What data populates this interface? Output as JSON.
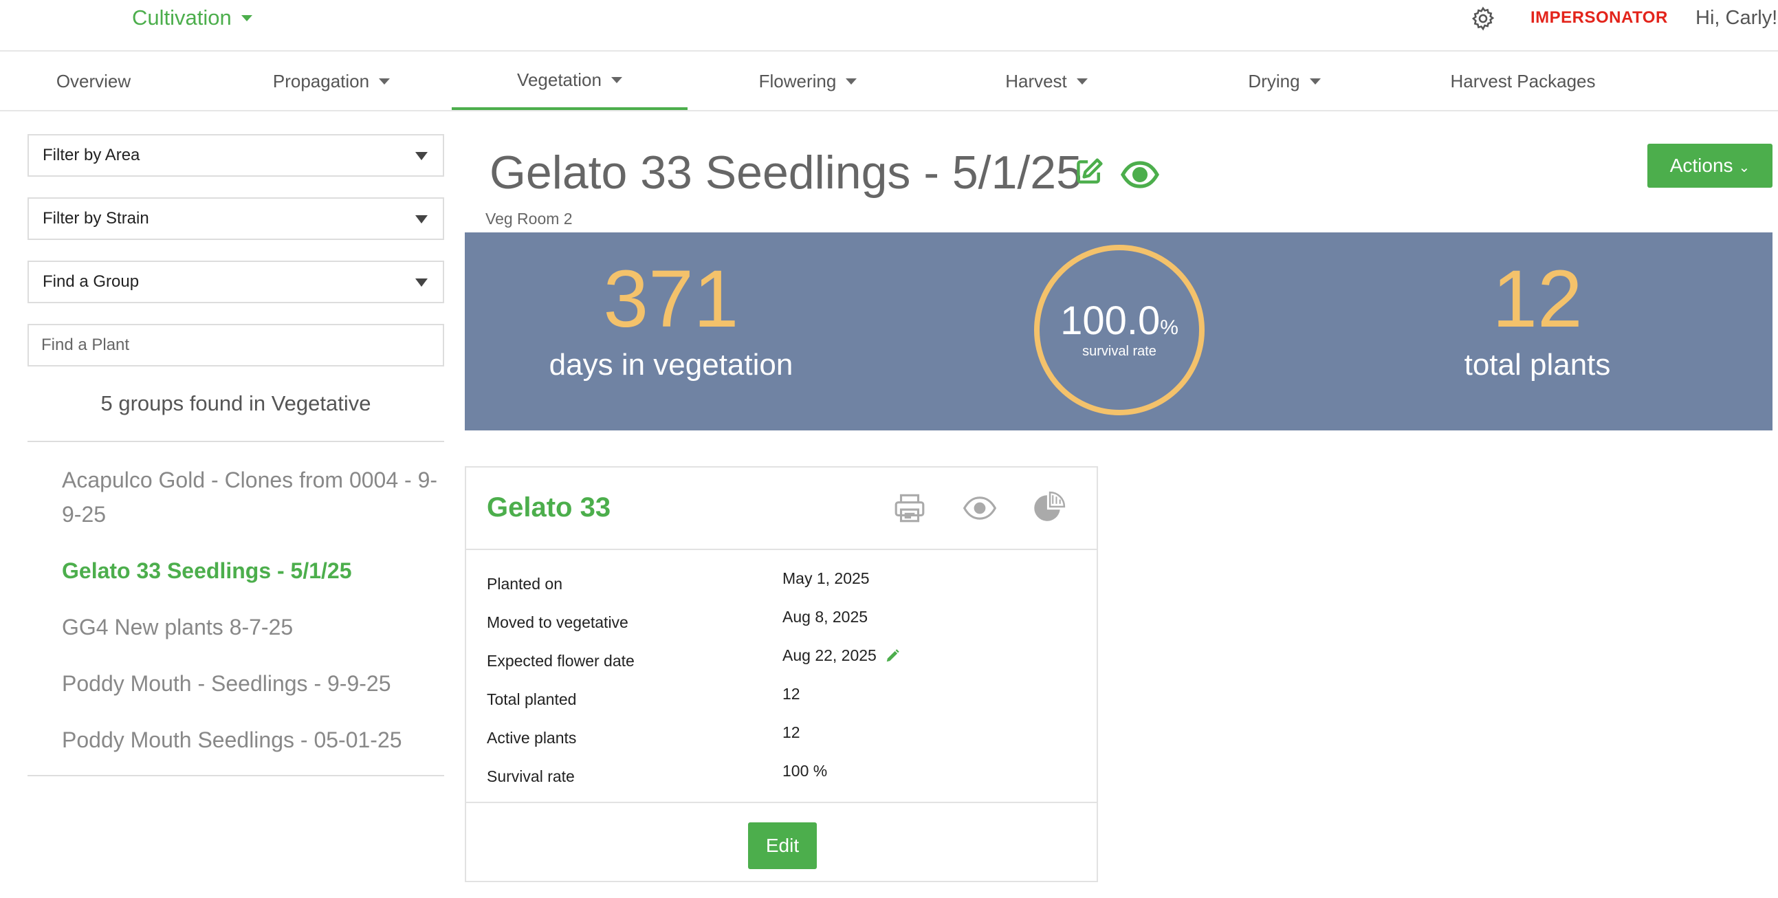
{
  "topbar": {
    "module": "Cultivation",
    "impersonator": "IMPERSONATOR",
    "greeting": "Hi, Carly!",
    "icons": {
      "settings": "gear-icon",
      "module_dropdown": "caret-down-icon"
    }
  },
  "nav": {
    "items": [
      {
        "label": "Overview",
        "dropdown": false,
        "active": false
      },
      {
        "label": "Propagation",
        "dropdown": true,
        "active": false
      },
      {
        "label": "Vegetation",
        "dropdown": true,
        "active": true
      },
      {
        "label": "Flowering",
        "dropdown": true,
        "active": false
      },
      {
        "label": "Harvest",
        "dropdown": true,
        "active": false
      },
      {
        "label": "Drying",
        "dropdown": true,
        "active": false
      },
      {
        "label": "Harvest Packages",
        "dropdown": false,
        "active": false
      }
    ]
  },
  "sidebar": {
    "filter_area": "Filter by Area",
    "filter_strain": "Filter by Strain",
    "find_group": "Find a Group",
    "find_plant_placeholder": "Find a Plant",
    "groups_found": "5 groups found in Vegetative",
    "groups": [
      "Acapulco Gold - Clones from 0004 - 9-9-25",
      "Gelato 33 Seedlings - 5/1/25",
      "GG4 New plants 8-7-25",
      "Poddy Mouth - Seedlings - 9-9-25",
      "Poddy Mouth Seedlings - 05-01-25"
    ],
    "active_group": "Gelato 33 Seedlings - 5/1/25"
  },
  "header": {
    "title": "Gelato 33 Seedlings - 5/1/25",
    "room": "Veg Room 2",
    "actions_label": "Actions"
  },
  "stats": {
    "days": "371",
    "days_label": "days in vegetation",
    "survival": "100.0",
    "survival_unit": "%",
    "survival_label": "survival rate",
    "survival_fraction": 1.0,
    "plants": "12",
    "plants_label": "total plants"
  },
  "card": {
    "title": "Gelato 33",
    "icons": [
      "printer-icon",
      "eye-icon",
      "pie-chart-icon"
    ],
    "rows": [
      {
        "label": "Planted on",
        "value": "May 1, 2025",
        "editable": false
      },
      {
        "label": "Moved to vegetative",
        "value": "Aug 8, 2025",
        "editable": false
      },
      {
        "label": "Expected flower date",
        "value": "Aug 22, 2025",
        "editable": true
      },
      {
        "label": "Total planted",
        "value": "12",
        "editable": false
      },
      {
        "label": "Active plants",
        "value": "12",
        "editable": false
      },
      {
        "label": "Survival rate",
        "value": "100 %",
        "editable": false
      }
    ],
    "edit_label": "Edit"
  },
  "colors": {
    "brand_green": "#4cae4c",
    "impersonator_red": "#e3241b",
    "banner_bg": "#7083a3",
    "stat_gold": "#f4c26b"
  }
}
